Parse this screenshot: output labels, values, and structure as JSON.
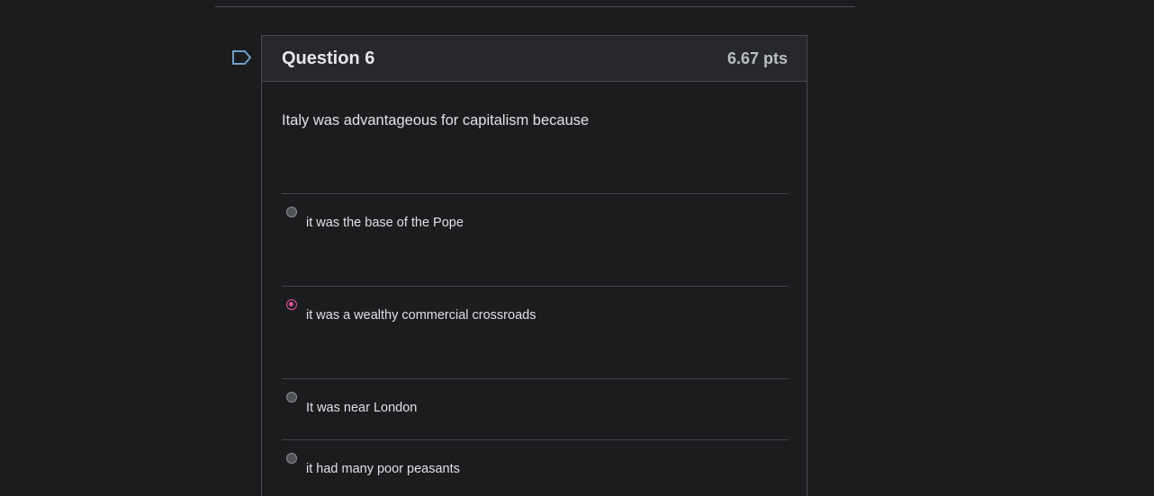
{
  "question": {
    "title": "Question 6",
    "points": "6.67 pts",
    "prompt": "Italy was advantageous for capitalism because",
    "answers": [
      {
        "label": "it was the base of the Pope",
        "selected": false
      },
      {
        "label": "it was a wealthy commercial crossroads",
        "selected": true
      },
      {
        "label": "It was near London",
        "selected": false
      },
      {
        "label": "it had many poor peasants",
        "selected": false
      }
    ]
  },
  "colors": {
    "background": "#1b1c1e",
    "header_background": "#27282b",
    "border": "#4a4c50",
    "selected_accent": "#e2559b",
    "flag_icon": "#6f9fc7"
  },
  "icons": {
    "flag": "flag-question-icon"
  }
}
